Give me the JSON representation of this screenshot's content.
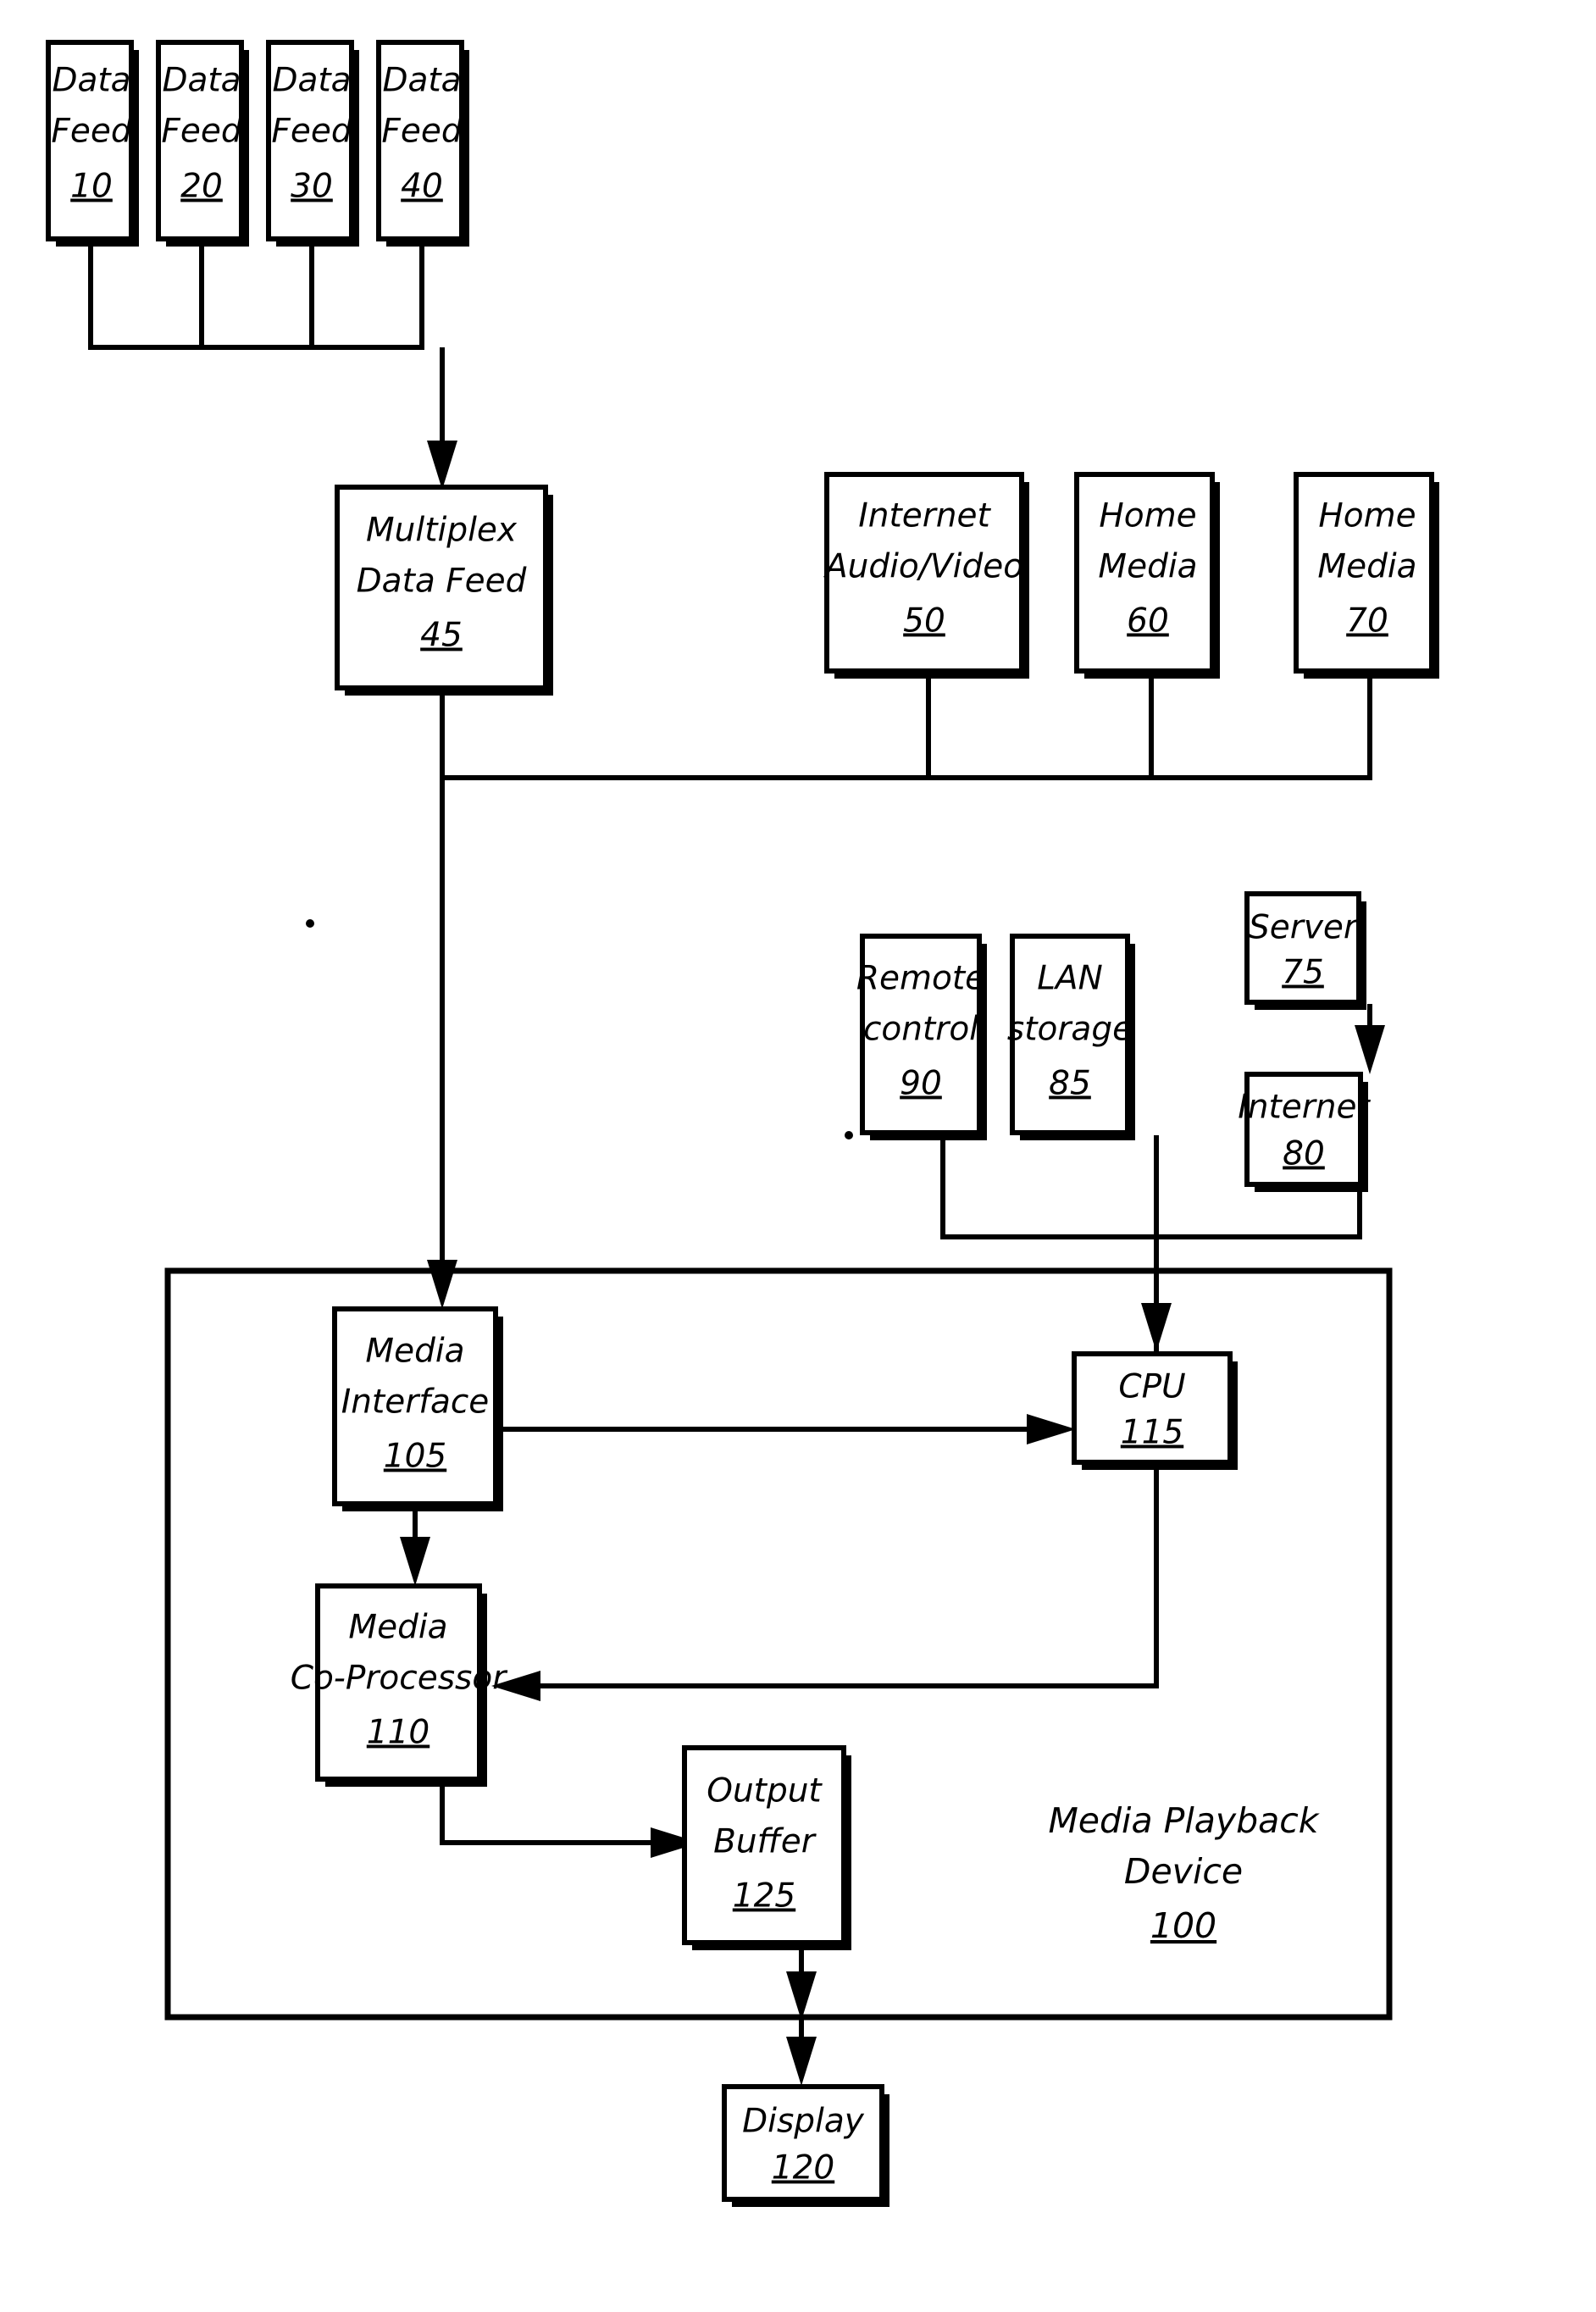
{
  "figure": {
    "kind": "patent-block-diagram",
    "background_color": "#ffffff",
    "line_color": "#000000"
  },
  "nodes": {
    "data_feed_10": {
      "line1": "Data",
      "line2": "Feed",
      "ref": "10"
    },
    "data_feed_20": {
      "line1": "Data",
      "line2": "Feed",
      "ref": "20"
    },
    "data_feed_30": {
      "line1": "Data",
      "line2": "Feed",
      "ref": "30"
    },
    "data_feed_40": {
      "line1": "Data",
      "line2": "Feed",
      "ref": "40"
    },
    "multiplex_data_feed": {
      "line1": "Multiplex",
      "line2": "Data Feed",
      "ref": "45"
    },
    "internet_audio_video": {
      "line1": "Internet",
      "line2": "Audio/Video",
      "ref": "50"
    },
    "home_media_60": {
      "line1": "Home",
      "line2": "Media",
      "ref": "60"
    },
    "home_media_70": {
      "line1": "Home",
      "line2": "Media",
      "ref": "70"
    },
    "remote_control": {
      "line1": "Remote",
      "line2": "control",
      "ref": "90"
    },
    "lan_storage": {
      "line1": "LAN",
      "line2": "storage",
      "ref": "85"
    },
    "server": {
      "line1": "Server",
      "line2": "",
      "ref": "75"
    },
    "internet_80": {
      "line1": "Internet",
      "line2": "",
      "ref": "80"
    },
    "media_interface": {
      "line1": "Media",
      "line2": "Interface",
      "ref": "105"
    },
    "cpu": {
      "line1": "CPU",
      "line2": "",
      "ref": "115"
    },
    "media_coprocessor": {
      "line1": "Media",
      "line2": "Co-Processor",
      "ref": "110"
    },
    "output_buffer": {
      "line1": "Output",
      "line2": "Buffer",
      "ref": "125"
    },
    "display": {
      "line1": "Display",
      "line2": "",
      "ref": "120"
    },
    "media_playback_device": {
      "line1": "Media Playback",
      "line2": "Device",
      "ref": "100"
    }
  }
}
